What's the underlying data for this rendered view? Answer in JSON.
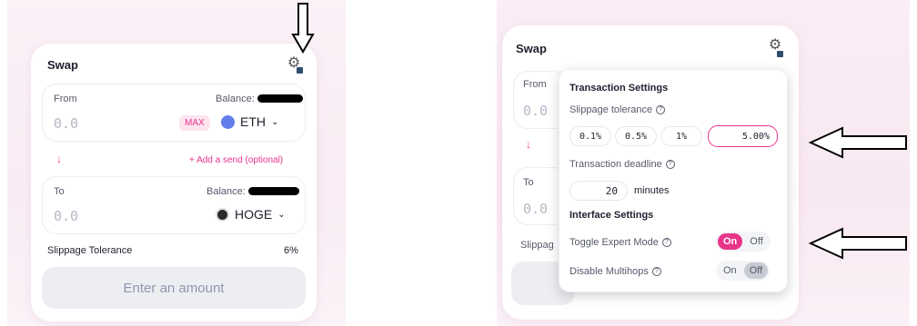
{
  "left": {
    "title": "Swap",
    "from_label": "From",
    "from_balance_label": "Balance:",
    "from_amount": "0.0",
    "max_label": "MAX",
    "from_token": "ETH",
    "add_send": "+ Add a send (optional)",
    "to_label": "To",
    "to_balance_label": "Balance:",
    "to_amount": "0.0",
    "to_token": "HOGE",
    "slippage_label": "Slippage Tolerance",
    "slippage_value": "6%",
    "enter_amount": "Enter an amount"
  },
  "right": {
    "title": "Swap",
    "from_label": "From",
    "from_amount": "0.0",
    "to_label": "To",
    "to_amount": "0.0",
    "slippage_partial": "Slippag",
    "settings": {
      "transaction_heading": "Transaction Settings",
      "slippage_label": "Slippage tolerance",
      "slippage_options": [
        "0.1%",
        "0.5%",
        "1%"
      ],
      "slippage_custom": "5.00",
      "slippage_custom_unit": "%",
      "deadline_label": "Transaction deadline",
      "deadline_value": "20",
      "deadline_unit": "minutes",
      "interface_heading": "Interface Settings",
      "expert_label": "Toggle Expert Mode",
      "expert_on": "On",
      "expert_off": "Off",
      "multihop_label": "Disable Multihops",
      "multihop_on": "On",
      "multihop_off": "Off"
    }
  },
  "icons": {
    "gear": "gear-icon",
    "help": "help-circle-icon",
    "eth": "ethereum-token-icon",
    "hoge": "hoge-token-icon",
    "chevron": "chevron-down-icon",
    "down_arrow": "arrow-down-icon"
  },
  "colors": {
    "accent": "#e8358a",
    "muted": "#b5b8c5",
    "button_bg": "#edeef2"
  }
}
